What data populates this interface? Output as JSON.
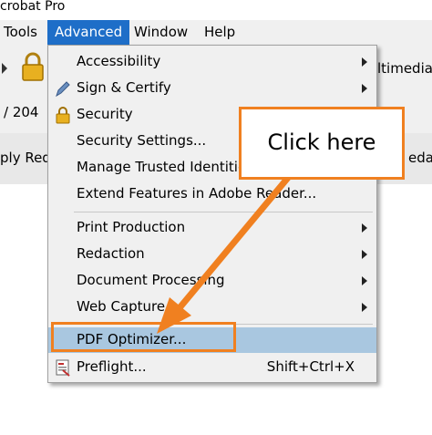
{
  "window": {
    "title": "crobat Pro"
  },
  "menubar": {
    "items": [
      {
        "label": "Tools"
      },
      {
        "label": "Advanced"
      },
      {
        "label": "Window"
      },
      {
        "label": "Help"
      }
    ]
  },
  "toolbar": {
    "multimedia_label": "ltimedia",
    "page_count": "/ 204",
    "apply_label": "ply Red",
    "reda_label": "eda"
  },
  "dropdown": {
    "items": [
      {
        "label": "Accessibility"
      },
      {
        "label": "Sign & Certify"
      },
      {
        "label": "Security"
      },
      {
        "label": "Security Settings..."
      },
      {
        "label": "Manage Trusted Identities"
      },
      {
        "label": "Extend Features in Adobe Reader..."
      },
      {
        "label": "Print Production"
      },
      {
        "label": "Redaction"
      },
      {
        "label": "Document Processing"
      },
      {
        "label": "Web Capture"
      },
      {
        "label": "PDF Optimizer..."
      },
      {
        "label": "Preflight...",
        "shortcut": "Shift+Ctrl+X"
      }
    ]
  },
  "callout": {
    "text": "Click here"
  },
  "colors": {
    "accent": "#f08020",
    "menu_active": "#1e6ec8",
    "highlight": "#a9c7e0"
  }
}
